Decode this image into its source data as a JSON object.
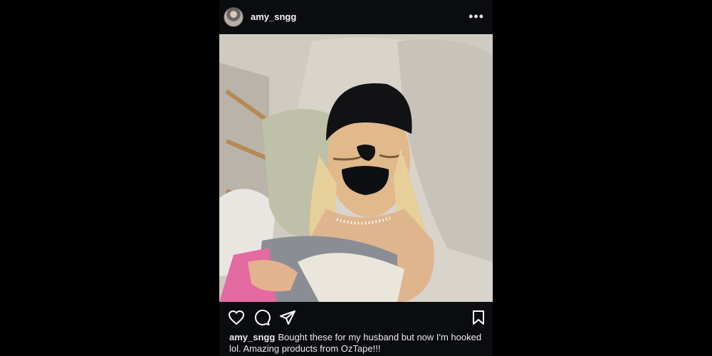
{
  "post": {
    "username": "amy_sngg",
    "more_label": "•••",
    "avatar_icon": "profile-photo",
    "photo_subject": "photo",
    "caption_user": "amy_sngg",
    "caption_text": "Bought these for my husband but now I'm hooked lol. Amazing products from OzTape!!!"
  },
  "actions": {
    "like_icon": "heart-icon",
    "comment_icon": "comment-icon",
    "share_icon": "send-icon",
    "save_icon": "bookmark-icon"
  },
  "colors": {
    "background": "#000000",
    "post_bg": "#0b0c10",
    "text": "#f5f5f5"
  }
}
